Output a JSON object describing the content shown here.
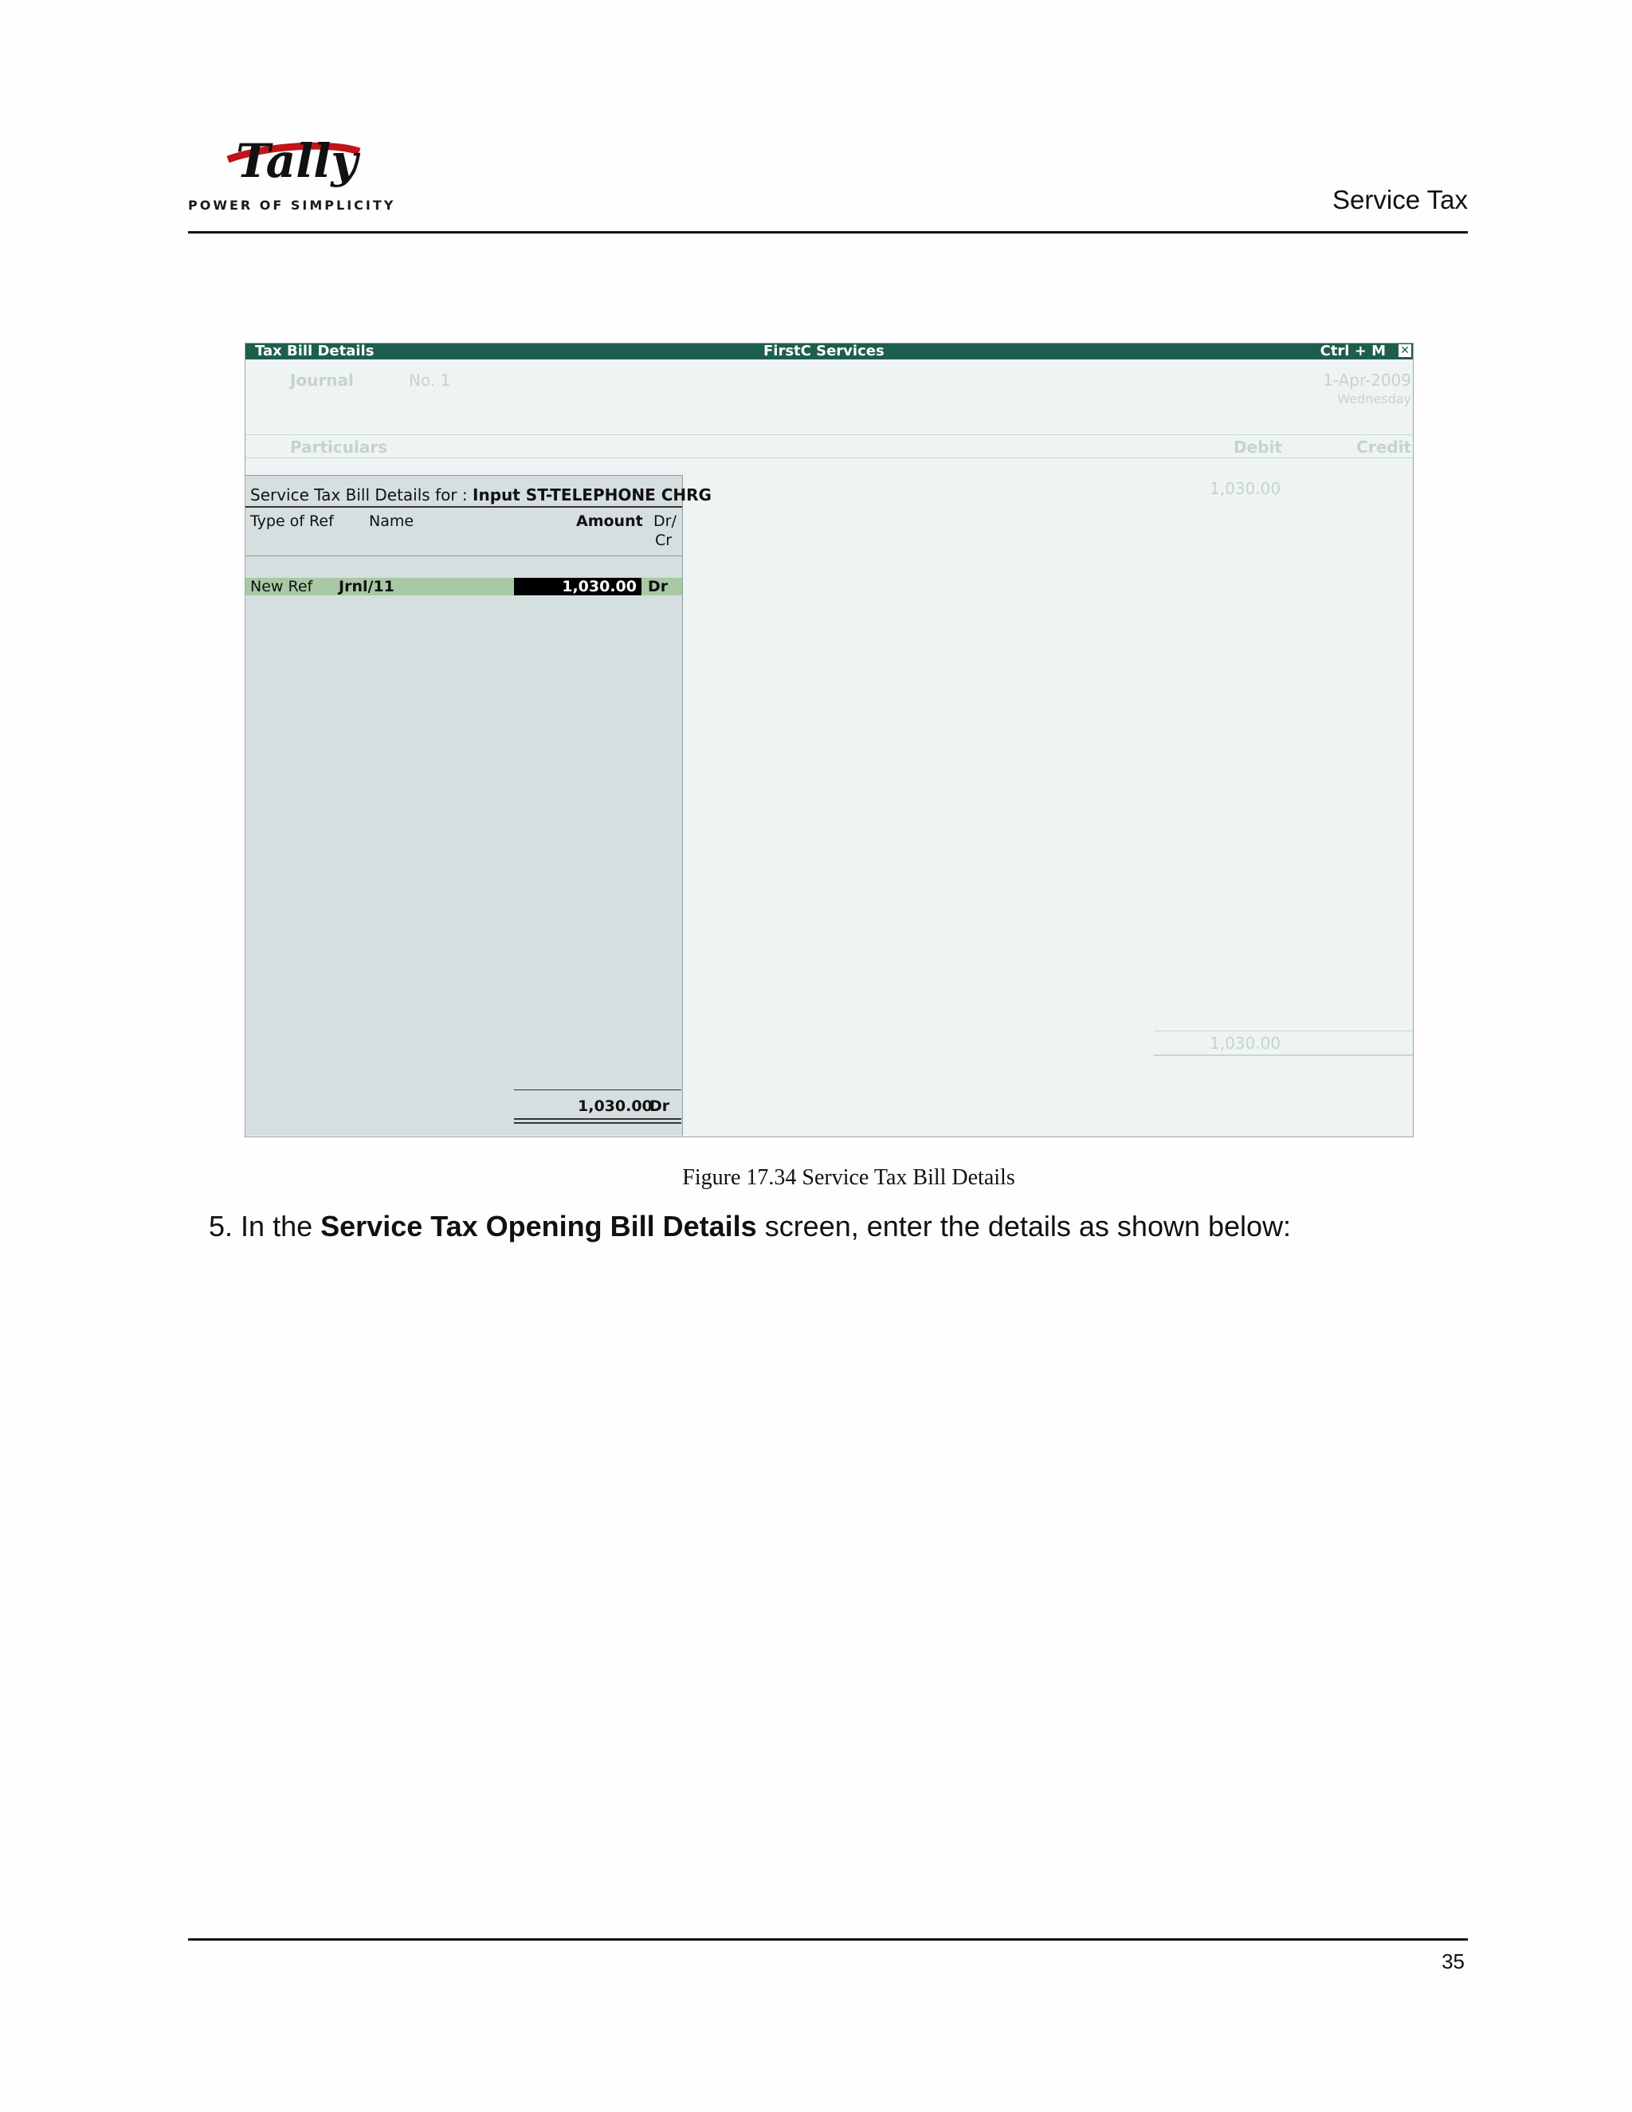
{
  "header": {
    "logo_text": "Tally",
    "tagline": "POWER OF SIMPLICITY",
    "section_title": "Service Tax"
  },
  "screenshot": {
    "titlebar": {
      "left": "Tax Bill Details",
      "center": "FirstC Services",
      "right": "Ctrl + M"
    },
    "voucher": {
      "type": "Journal",
      "number": "No. 1",
      "date": "1-Apr-2009",
      "day": "Wednesday",
      "particulars_label": "Particulars",
      "debit_label": "Debit",
      "credit_label": "Credit",
      "debit_amount": "1,030.00",
      "debit_total": "1,030.00"
    },
    "panel": {
      "title_prefix": "Service Tax Bill Details for :",
      "ledger": "Input ST-TELEPHONE CHRG",
      "columns": {
        "type": "Type of Ref",
        "name": "Name",
        "amount": "Amount",
        "drcr_1": "Dr/",
        "drcr_2": "Cr"
      },
      "entry": {
        "type": "New Ref",
        "name": "Jrnl/11",
        "amount": "1,030.00",
        "drcr": "Dr"
      },
      "total": {
        "amount": "1,030.00",
        "drcr": "Dr"
      }
    }
  },
  "caption": "Figure 17.34  Service Tax Bill Details",
  "step": {
    "number": "5.",
    "pre": "In the",
    "bold": "Service Tax Opening Bill Details",
    "post": "screen, enter the details as shown below:"
  },
  "page_number": "35"
}
